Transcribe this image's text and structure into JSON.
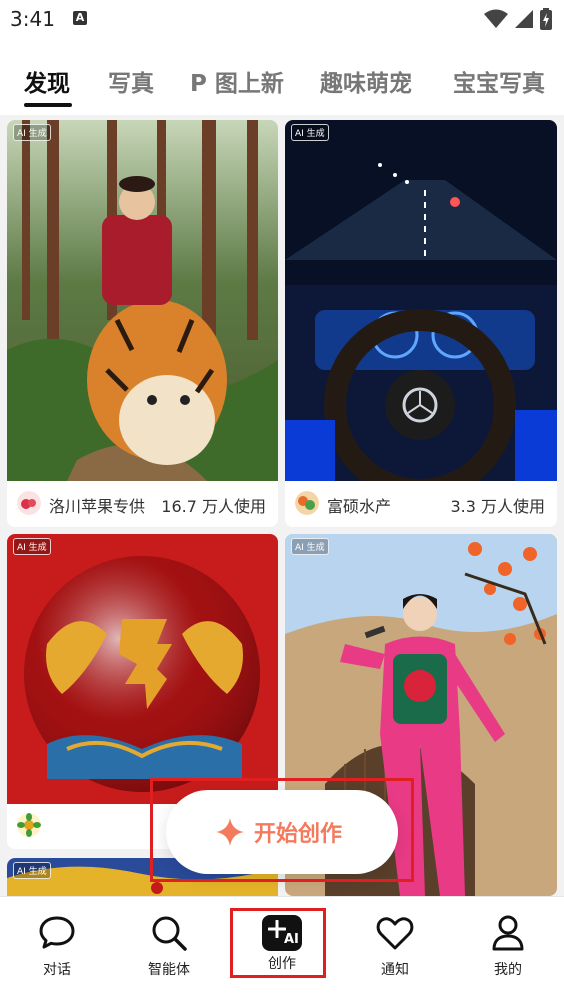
{
  "status": {
    "time": "3:41",
    "notification_icon": "A"
  },
  "tabs": [
    {
      "label": "发现",
      "active": true
    },
    {
      "label": "写真"
    },
    {
      "label": "P 图上新"
    },
    {
      "label": "趣味萌宠"
    },
    {
      "label": "宝宝写真"
    }
  ],
  "cards": [
    {
      "badge": "AI 生成",
      "author": "洛川苹果专供",
      "uses": "16.7 万人使用"
    },
    {
      "badge": "AI 生成",
      "author": "富硕水产",
      "uses": "3.3 万人使用"
    },
    {
      "badge": "AI 生成",
      "author": "",
      "uses": ""
    },
    {
      "badge": "AI 生成"
    },
    {
      "badge": "AI 生成"
    }
  ],
  "fab": {
    "label": "开始创作"
  },
  "nav": [
    {
      "label": "对话",
      "icon": "chat-bubble-icon"
    },
    {
      "label": "智能体",
      "icon": "search-icon"
    },
    {
      "label": "创作",
      "icon": "ai-create-icon",
      "icon_text": "AI"
    },
    {
      "label": "通知",
      "icon": "heart-icon"
    },
    {
      "label": "我的",
      "icon": "person-icon"
    }
  ],
  "colors": {
    "accent": "#f37a5d",
    "highlight": "#e02020"
  }
}
